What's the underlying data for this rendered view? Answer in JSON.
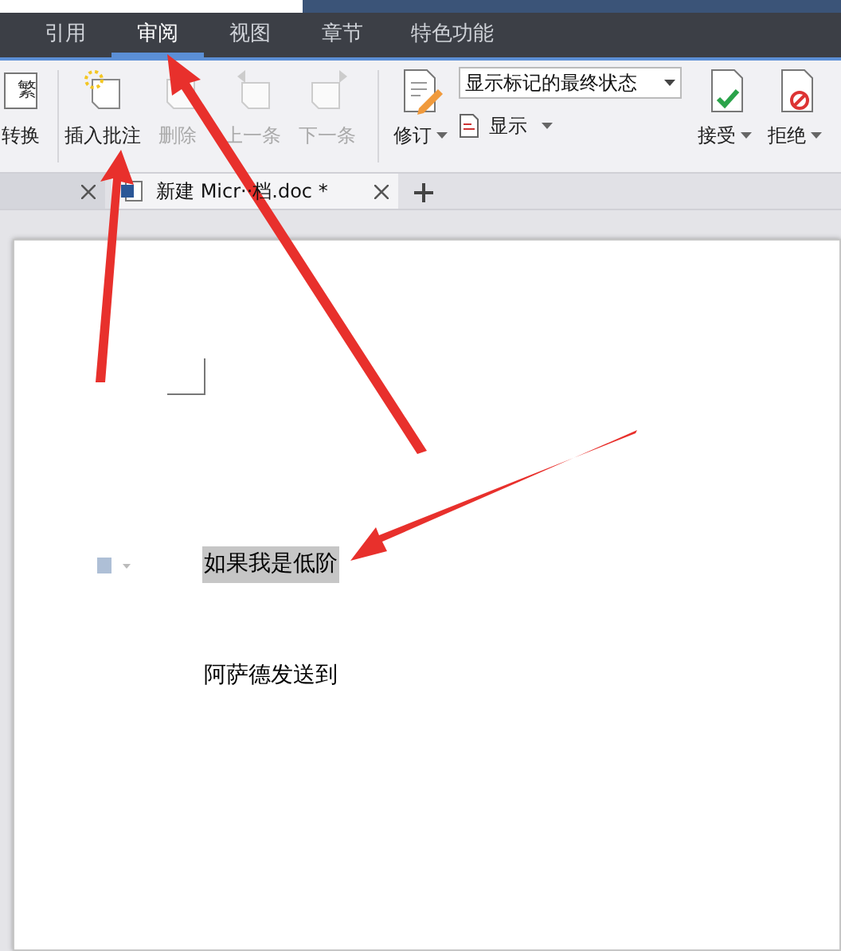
{
  "menu_tabs": [
    {
      "label": "引用",
      "selected": false
    },
    {
      "label": "审阅",
      "selected": true
    },
    {
      "label": "视图",
      "selected": false
    },
    {
      "label": "章节",
      "selected": false
    },
    {
      "label": "特色功能",
      "selected": false
    }
  ],
  "ribbon": {
    "left_buttons": [
      {
        "kind": "convert",
        "label": "转换",
        "icon_text": "繁",
        "disabled": false
      },
      {
        "kind": "comment",
        "label": "插入批注",
        "disabled": false
      },
      {
        "kind": "delete",
        "label": "删除",
        "disabled": true
      },
      {
        "kind": "prev",
        "label": "上一条",
        "disabled": true
      },
      {
        "kind": "next",
        "label": "下一条",
        "disabled": true
      }
    ],
    "track_button": {
      "label": "修订"
    },
    "markup_select": {
      "value": "显示标记的最终状态"
    },
    "show_button": {
      "label": "显示"
    },
    "right_buttons": [
      {
        "kind": "accept",
        "label": "接受"
      },
      {
        "kind": "reject",
        "label": "拒绝"
      }
    ]
  },
  "doc_tabs": [
    {
      "selected": false
    },
    {
      "label": "新建 Micr··档.doc *",
      "selected": true
    }
  ],
  "document": {
    "paragraphs": [
      {
        "text": "如果我是低阶",
        "highlighted": true
      },
      {
        "text": "阿萨德发送到",
        "highlighted": false
      }
    ]
  }
}
